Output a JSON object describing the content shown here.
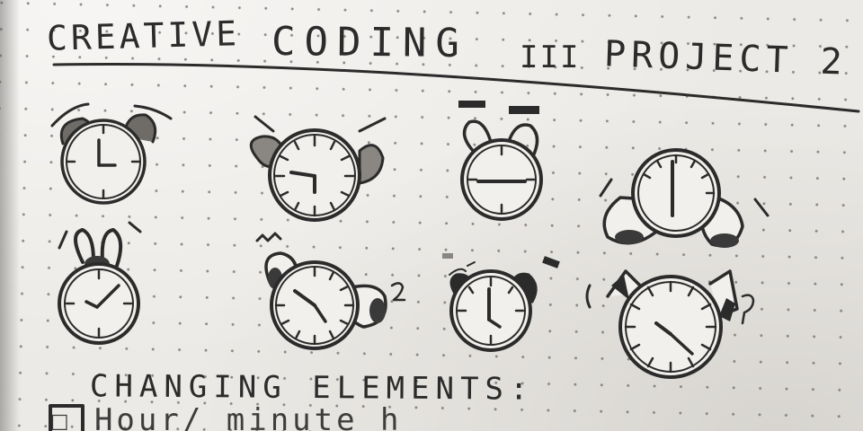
{
  "title": {
    "left": "CREATIVE",
    "middle": "CODING",
    "separator": "III",
    "right": "PROJECT 2"
  },
  "sub_heading": "CHANGING ELEMENTS:",
  "checklist_fragment": "☐ Hour/ minute h",
  "colors": {
    "paper": "#eceae6",
    "ink": "#2b2b2b",
    "pencil": "#4a4a4a",
    "dots": "#6b6864"
  },
  "sketches": [
    {
      "name": "alarm-clock-1",
      "hands": "3:00"
    },
    {
      "name": "alarm-clock-2",
      "hands": "9:15"
    },
    {
      "name": "alarm-clock-3",
      "hands": "3:45"
    },
    {
      "name": "alarm-clock-4",
      "hands": "12:30"
    },
    {
      "name": "alarm-clock-5",
      "hands": "8:05"
    },
    {
      "name": "alarm-clock-6",
      "hands": "10:25"
    },
    {
      "name": "alarm-clock-7",
      "hands": "12:25"
    },
    {
      "name": "alarm-clock-8",
      "hands": "2:20"
    }
  ]
}
